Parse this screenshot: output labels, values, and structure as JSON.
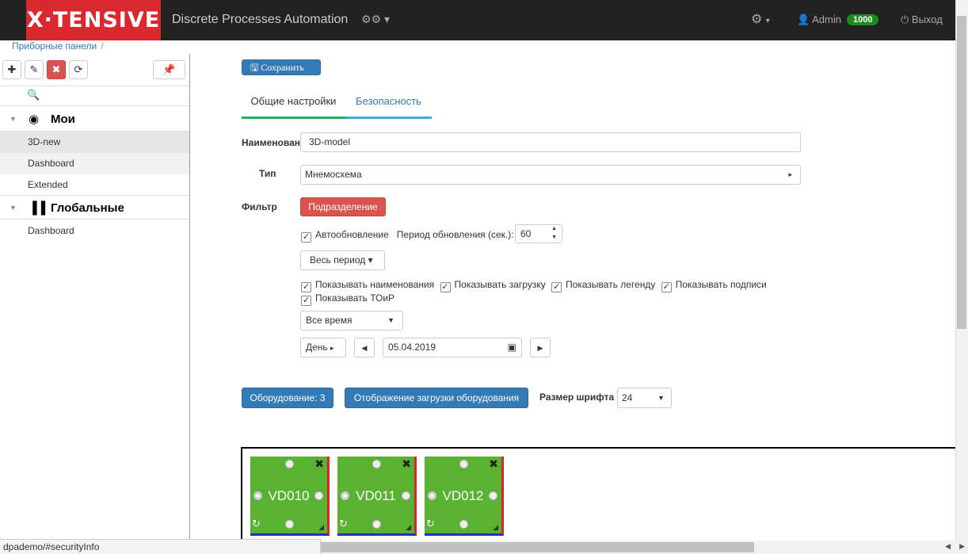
{
  "app": {
    "logo": "X·TENSIVE",
    "title": "Discrete Processes Automation",
    "cogs_icon": "cogs-icon",
    "user": "Admin",
    "badge": "1000",
    "logout": "Выход"
  },
  "breadcrumb": {
    "label": "Приборные панели"
  },
  "sidebar": {
    "groups": [
      {
        "label": "Мои",
        "items": [
          "3D-new",
          "Dashboard",
          "Extended"
        ]
      },
      {
        "label": "Глобальные",
        "items": [
          "Dashboard"
        ]
      }
    ]
  },
  "form": {
    "save": "Сохранить",
    "tabs": [
      "Общие настройки",
      "Безопасность"
    ],
    "name_label": "Наименован",
    "name_value": "3D-model",
    "type_label": "Тип",
    "type_value": "Мнемосхема",
    "filter_label": "Фильтр",
    "filter_btn": "Подразделение",
    "auto": "Автообновление",
    "period_label": "Период обновления (сек.):",
    "period_value": "60",
    "range_btn": "Весь период",
    "checks": [
      "Показывать наименования",
      "Показывать загрузку",
      "Показывать легенду",
      "Показывать подписи",
      "Показывать ТОиР"
    ],
    "time_select": "Все время",
    "day_btn": "День",
    "date": "05.04.2019",
    "equip_btn": "Оборудование: 3",
    "load_btn": "Отображение загрузки оборудования",
    "font_label": "Размер шрифта",
    "font_value": "24"
  },
  "equipment": [
    "VD010",
    "VD011",
    "VD012"
  ],
  "status_url": "dpademo/#securityInfo"
}
